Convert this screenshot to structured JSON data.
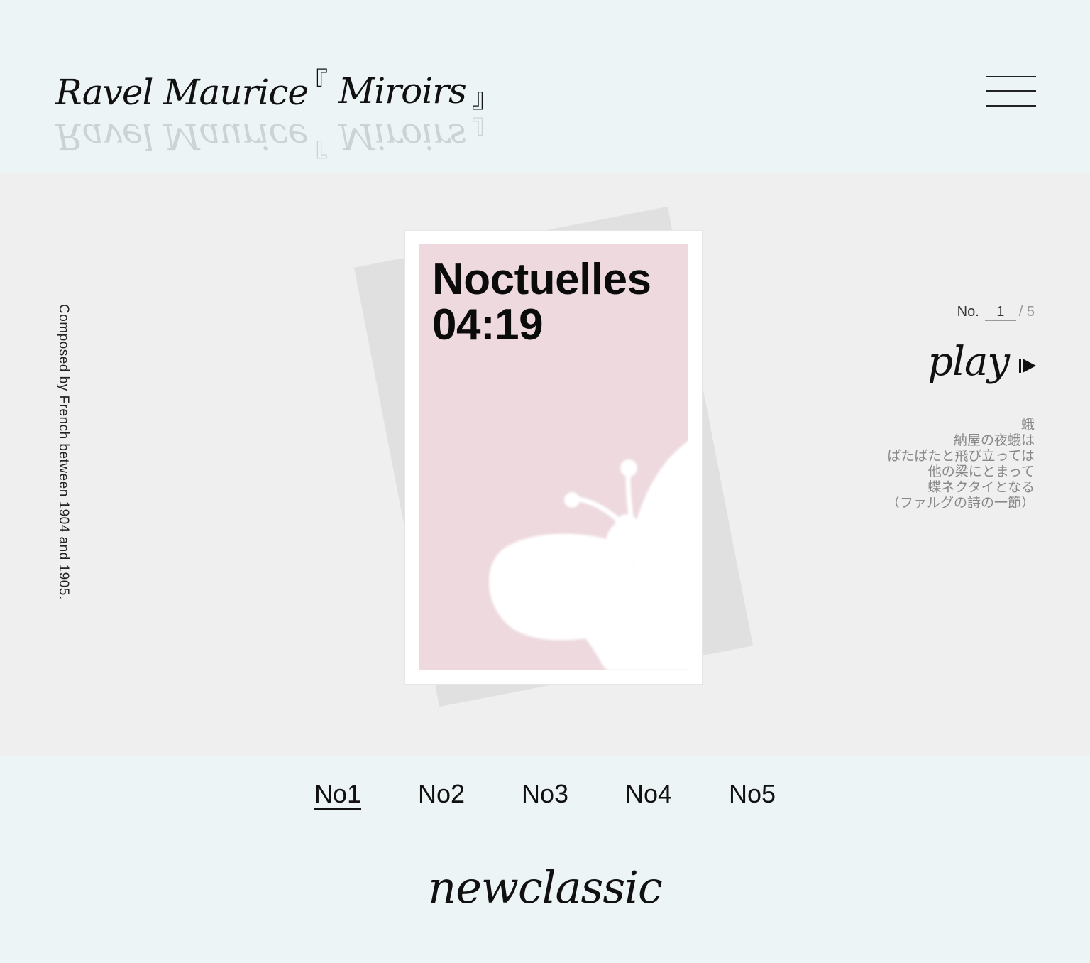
{
  "header": {
    "composer": "Ravel Maurice",
    "album_open_bracket": "『",
    "album_title": "Miroirs",
    "album_close_bracket": "』",
    "menu_icon": "hamburger-menu-icon"
  },
  "side_note": "Composed by French between 1904 and 1905.",
  "card": {
    "title": "Noctuelles",
    "duration": "04:19",
    "illustration": "moth-icon",
    "background_color": "#edd9de"
  },
  "track": {
    "prefix": "No.",
    "current": "1",
    "separator_total": "/ 5"
  },
  "play": {
    "label": "play",
    "icon": "play-triangle-icon"
  },
  "poem": [
    "蛾",
    "納屋の夜蛾は",
    "ばたばたと飛び立っては",
    "他の梁にとまって",
    "蝶ネクタイとなる",
    "（ファルグの詩の一節）"
  ],
  "tabs": [
    {
      "label": "No1",
      "active": true
    },
    {
      "label": "No2",
      "active": false
    },
    {
      "label": "No3",
      "active": false
    },
    {
      "label": "No4",
      "active": false
    },
    {
      "label": "No5",
      "active": false
    }
  ],
  "footer": {
    "logo": "newclassic"
  }
}
